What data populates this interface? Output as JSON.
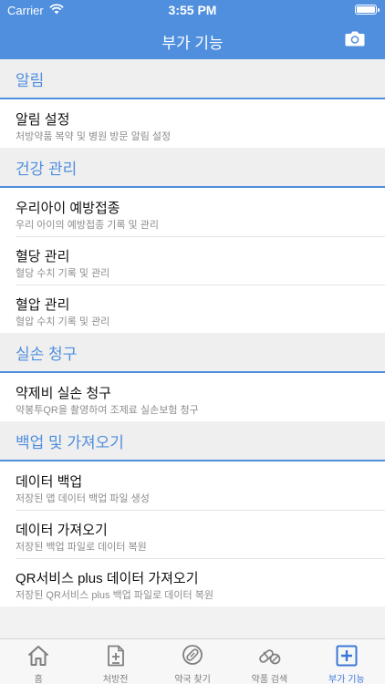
{
  "status_bar": {
    "carrier": "Carrier",
    "time": "3:55 PM",
    "battery_level": 1.0
  },
  "header": {
    "title": "부가 기능",
    "action_icon": "camera-icon"
  },
  "colors": {
    "accent": "#4f8fde",
    "tab_active": "#3b78d8",
    "section_bg": "#efefef"
  },
  "sections": [
    {
      "title": "알림",
      "items": [
        {
          "title": "알림 설정",
          "subtitle": "처방약품 복약 및 병원 방문 알림 설정"
        }
      ]
    },
    {
      "title": "건강 관리",
      "items": [
        {
          "title": "우리아이 예방접종",
          "subtitle": "우리 아이의 예방접종 기록 및 관리"
        },
        {
          "title": "혈당 관리",
          "subtitle": "혈당 수치 기록 및 관리"
        },
        {
          "title": "혈압 관리",
          "subtitle": "혈압 수치 기록 및 관리"
        }
      ]
    },
    {
      "title": "실손 청구",
      "items": [
        {
          "title": "약제비 실손 청구",
          "subtitle": "약봉투QR을 촬영하여 조제료 실손보험 청구"
        }
      ]
    },
    {
      "title": "백업 및 가져오기",
      "items": [
        {
          "title": "데이터 백업",
          "subtitle": "저장된 앱 데이터 백업 파일 생성"
        },
        {
          "title": "데이터 가져오기",
          "subtitle": "저장된 백업 파일로 데이터 복원"
        },
        {
          "title": "QR서비스 plus 데이터 가져오기",
          "subtitle": "저장된 QR서비스 plus 백업 파일로 데이터 복원"
        }
      ]
    }
  ],
  "tabbar": [
    {
      "label": "홈",
      "icon": "home-icon"
    },
    {
      "label": "처방전",
      "icon": "prescription-icon"
    },
    {
      "label": "약국 찾기",
      "icon": "pill-location-icon"
    },
    {
      "label": "약품 검색",
      "icon": "capsule-icon"
    },
    {
      "label": "부가 기능",
      "icon": "plus-square-icon",
      "active": true
    }
  ]
}
